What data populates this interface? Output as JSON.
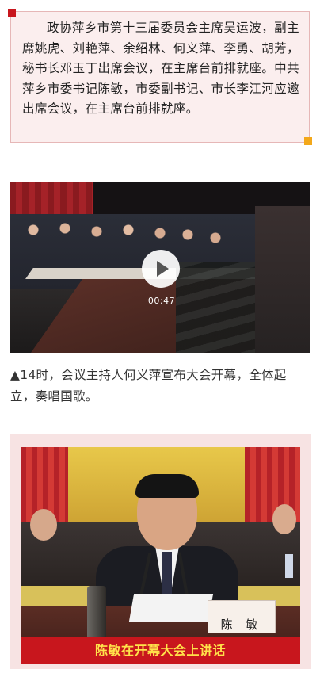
{
  "notice": {
    "text": "政协萍乡市第十三届委员会主席吴运波，副主席姚虎、刘艳萍、余绍林、何义萍、李勇、胡芳，秘书长邓玉丁出席会议，在主席台前排就座。中共萍乡市委书记陈敏，市委副书记、市长李江河应邀出席会议，在主席台前排就座。"
  },
  "video": {
    "duration": "00:47",
    "play_icon": "play-icon"
  },
  "caption": {
    "text": "▲14时，会议主持人何义萍宣布大会开幕，全体起立，奏唱国歌。"
  },
  "photo": {
    "nameplate": "陈 敏",
    "caption": "陈敏在开幕大会上讲话"
  },
  "colors": {
    "accent_red": "#c8161d",
    "accent_yellow": "#f3a81a",
    "caption_text": "#ffe24a"
  }
}
